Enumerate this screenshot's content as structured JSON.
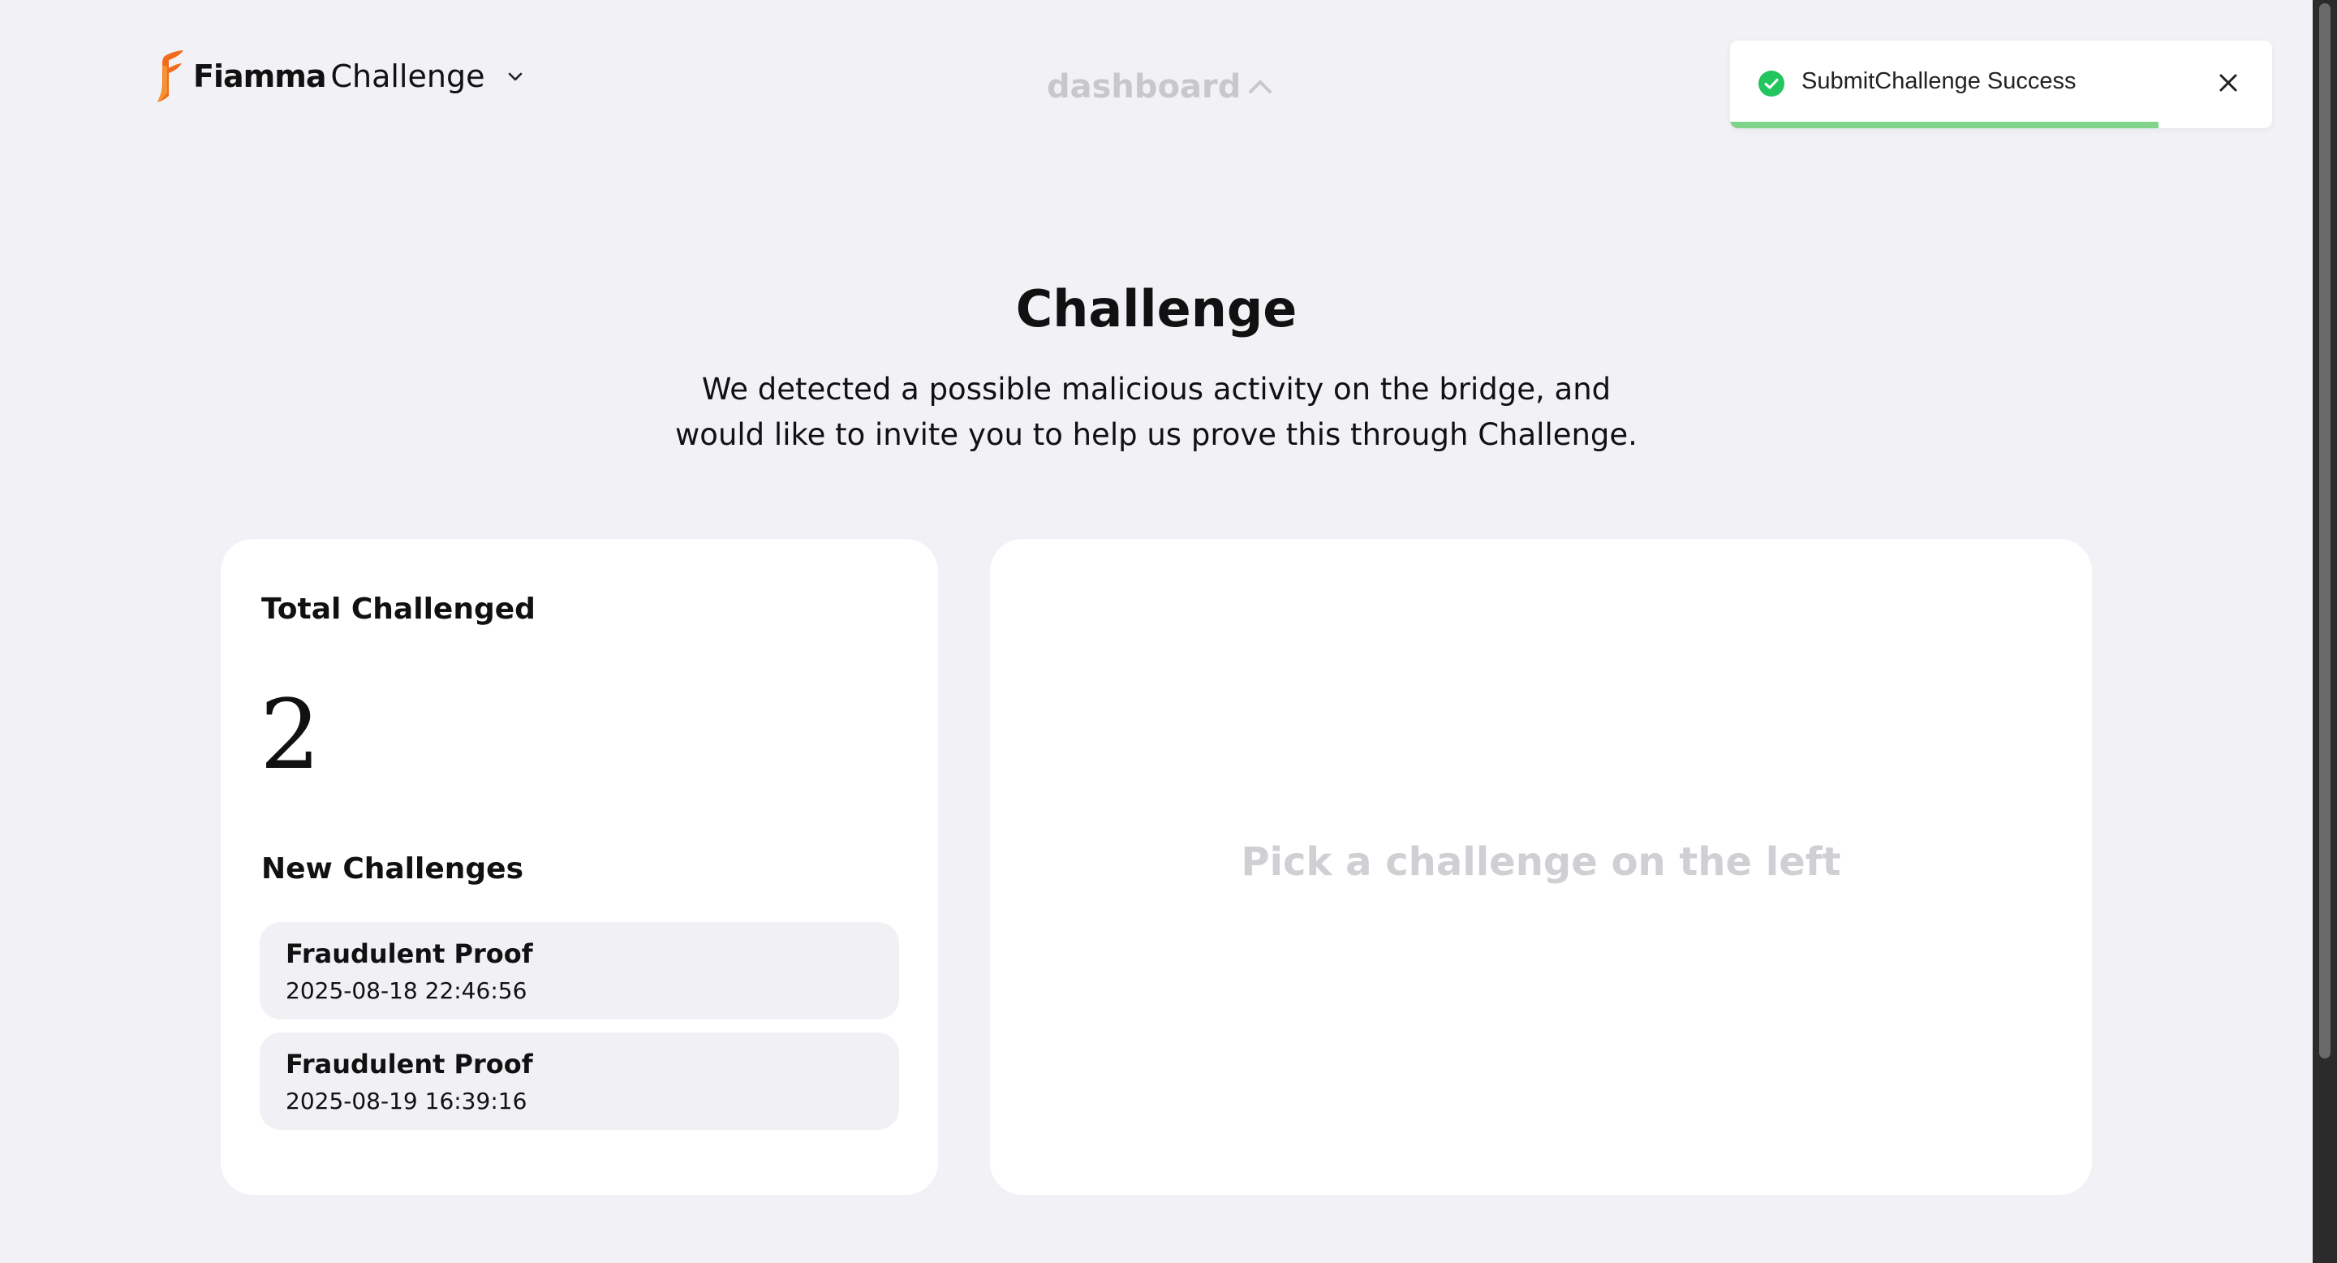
{
  "header": {
    "brand_word": "Fiamma",
    "app_name": "Challenge",
    "dashboard_label": "dashboard"
  },
  "toast": {
    "message": "SubmitChallenge Success",
    "status": "success",
    "progress_fraction": 0.79,
    "accent_color": "#22c55e"
  },
  "hero": {
    "title": "Challenge",
    "line1": "We detected a possible malicious activity on the bridge, and",
    "line2": "would like to invite you to help us prove this through Challenge."
  },
  "stats": {
    "total_label": "Total Challenged",
    "total_value": "2",
    "new_label": "New Challenges"
  },
  "challenges": [
    {
      "title": "Fraudulent Proof",
      "date": "2025-08-18 22:46:56"
    },
    {
      "title": "Fraudulent Proof",
      "date": "2025-08-19 16:39:16"
    }
  ],
  "detail": {
    "placeholder": "Pick a challenge on the left"
  },
  "colors": {
    "background": "#f2f2f6",
    "card": "#ffffff",
    "logo_orange": "#f26b1d",
    "muted_text": "#c8c8cc"
  }
}
